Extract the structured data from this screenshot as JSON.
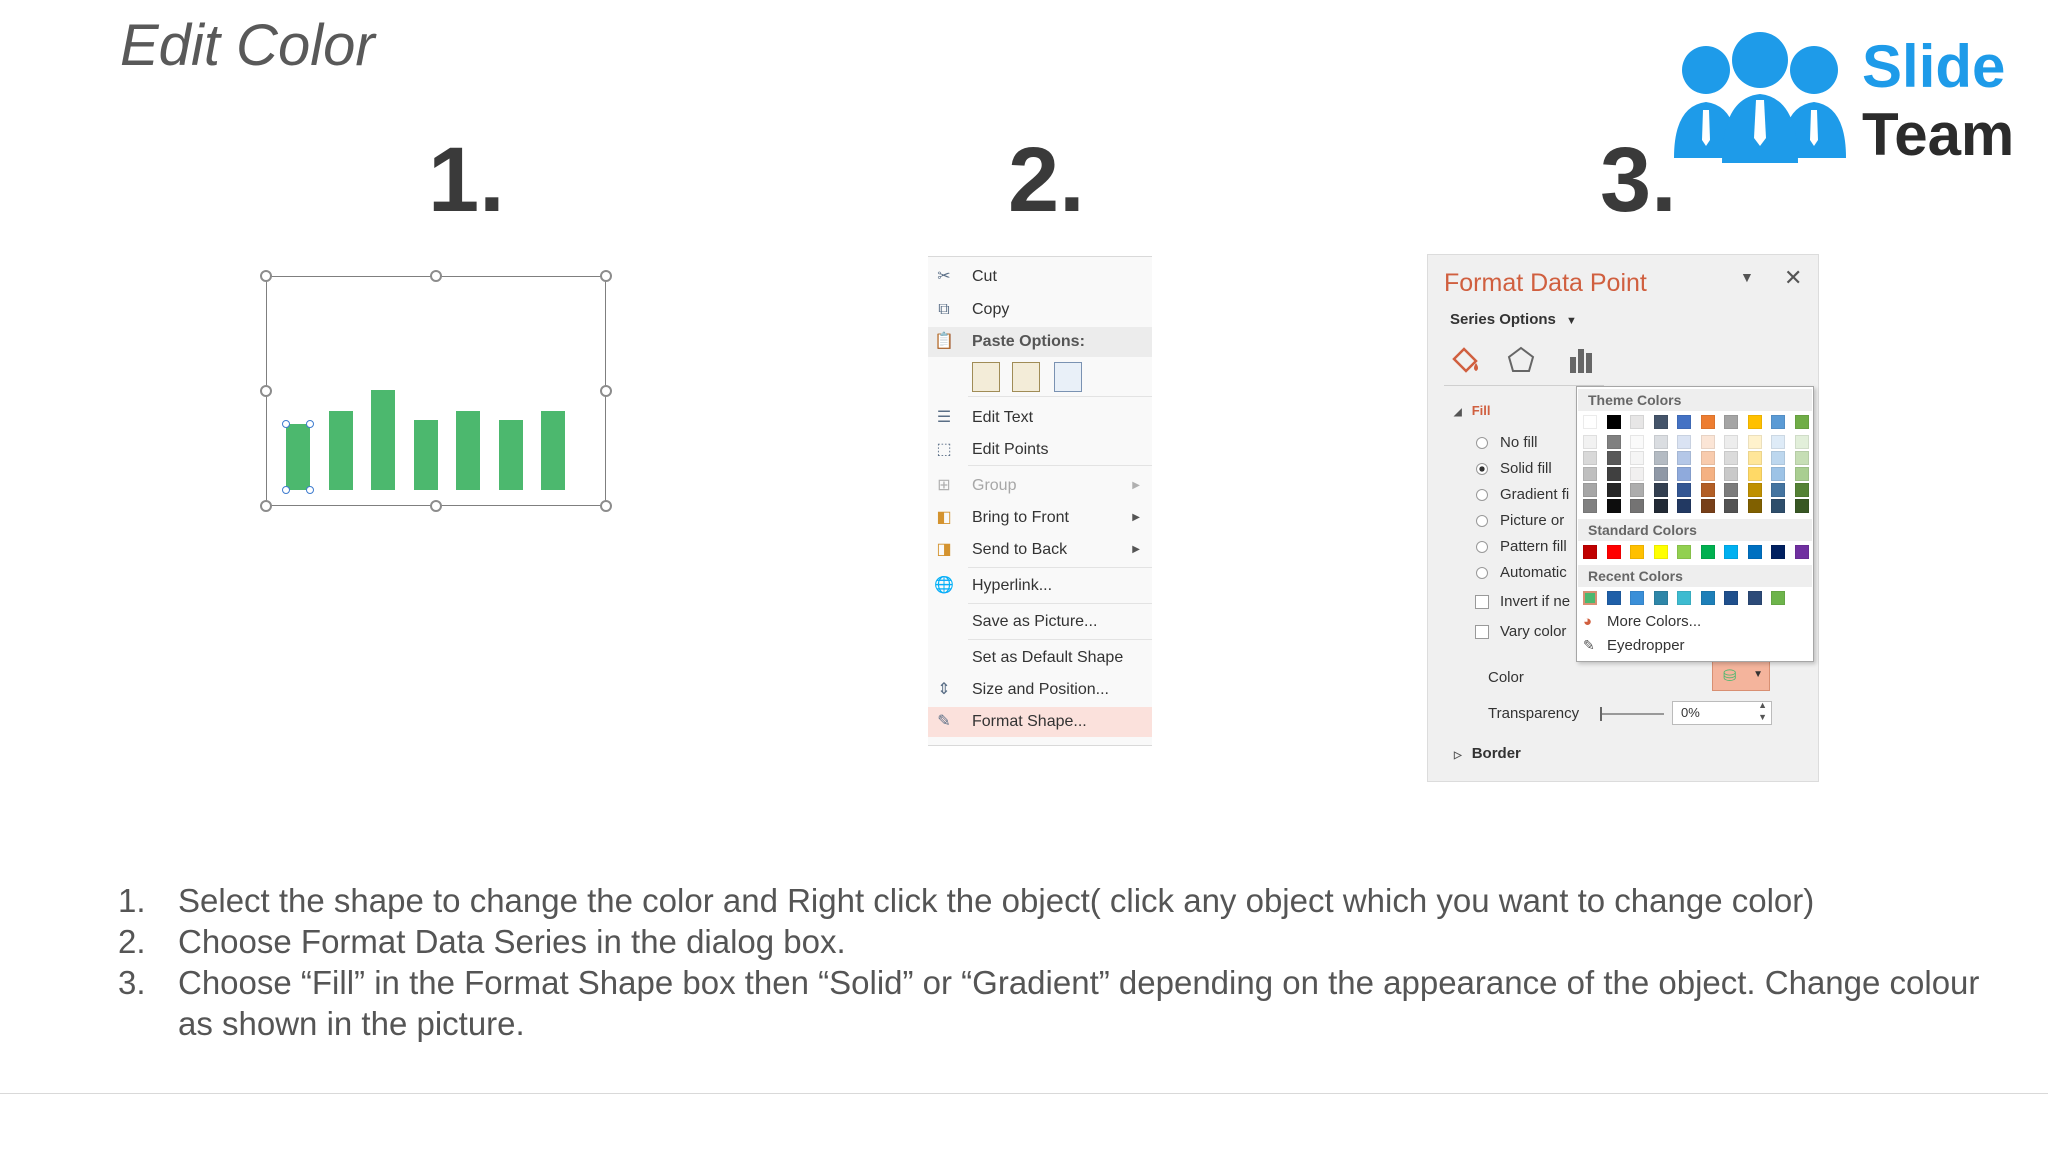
{
  "slide": {
    "title": "Edit Color"
  },
  "steps": {
    "one": "1.",
    "two": "2.",
    "three": "3."
  },
  "logo": {
    "line1": "Slide",
    "line2": "Team",
    "brand_color": "#1e9be9"
  },
  "panel1": {
    "bar_color": "#4cb86e",
    "bar_heights_relative": [
      0.66,
      0.79,
      1.0,
      0.7,
      0.79,
      0.7,
      0.79
    ]
  },
  "context_menu": {
    "items": [
      {
        "label": "Cut",
        "icon": "scissors-icon"
      },
      {
        "label": "Copy",
        "icon": "copy-icon"
      },
      {
        "label": "Paste Options:",
        "icon": "paste-icon"
      },
      {
        "label": "Edit Text",
        "icon": "edit-text-icon"
      },
      {
        "label": "Edit Points",
        "icon": "edit-points-icon"
      },
      {
        "label": "Group",
        "icon": "group-icon",
        "disabled": true
      },
      {
        "label": "Bring to Front",
        "icon": "bring-front-icon"
      },
      {
        "label": "Send to Back",
        "icon": "send-back-icon"
      },
      {
        "label": "Hyperlink...",
        "icon": "hyperlink-icon"
      },
      {
        "label": "Save as Picture..."
      },
      {
        "label": "Set as Default Shape"
      },
      {
        "label": "Size and Position...",
        "icon": "size-position-icon"
      },
      {
        "label": "Format Shape...",
        "icon": "format-shape-icon",
        "highlighted": true
      }
    ]
  },
  "format_pane": {
    "title": "Format Data Point",
    "series_options": "Series Options",
    "section_fill": "Fill",
    "fill_options": [
      "No fill",
      "Solid fill",
      "Gradient fi",
      "Picture or",
      "Pattern fill",
      "Automatic"
    ],
    "selected_fill": "Solid fill",
    "checkboxes": [
      "Invert if ne",
      "Vary color"
    ],
    "color_label": "Color",
    "transparency_label": "Transparency",
    "transparency_value": "0%",
    "section_border": "Border",
    "palette": {
      "theme_header": "Theme Colors",
      "standard_header": "Standard Colors",
      "recent_header": "Recent Colors",
      "more_colors": "More Colors...",
      "eyedropper": "Eyedropper",
      "theme_top": [
        "#ffffff",
        "#000000",
        "#e7e6e6",
        "#44546a",
        "#4472c4",
        "#ed7d31",
        "#a5a5a5",
        "#ffc000",
        "#5b9bd5",
        "#70ad47"
      ],
      "standard": [
        "#c00000",
        "#ff0000",
        "#ffc000",
        "#ffff00",
        "#92d050",
        "#00b050",
        "#00b0f0",
        "#0070c0",
        "#002060",
        "#7030a0"
      ],
      "recent": [
        "#4cb86e",
        "#1f5fa8",
        "#3a8fd8",
        "#2e86a8",
        "#3dbbd0",
        "#1d7fb8",
        "#1f4f8c",
        "#2c4a78",
        "#6db44b"
      ]
    }
  },
  "instructions": [
    {
      "num": "1.",
      "text": "Select the shape to change the color and Right click the object( click any object which you want to change color)"
    },
    {
      "num": "2.",
      "text": "Choose Format Data Series in the dialog box."
    },
    {
      "num": "3.",
      "text": "Choose “Fill” in the Format Shape box then “Solid” or “Gradient” depending on the appearance of the object. Change colour as shown in the picture."
    }
  ]
}
